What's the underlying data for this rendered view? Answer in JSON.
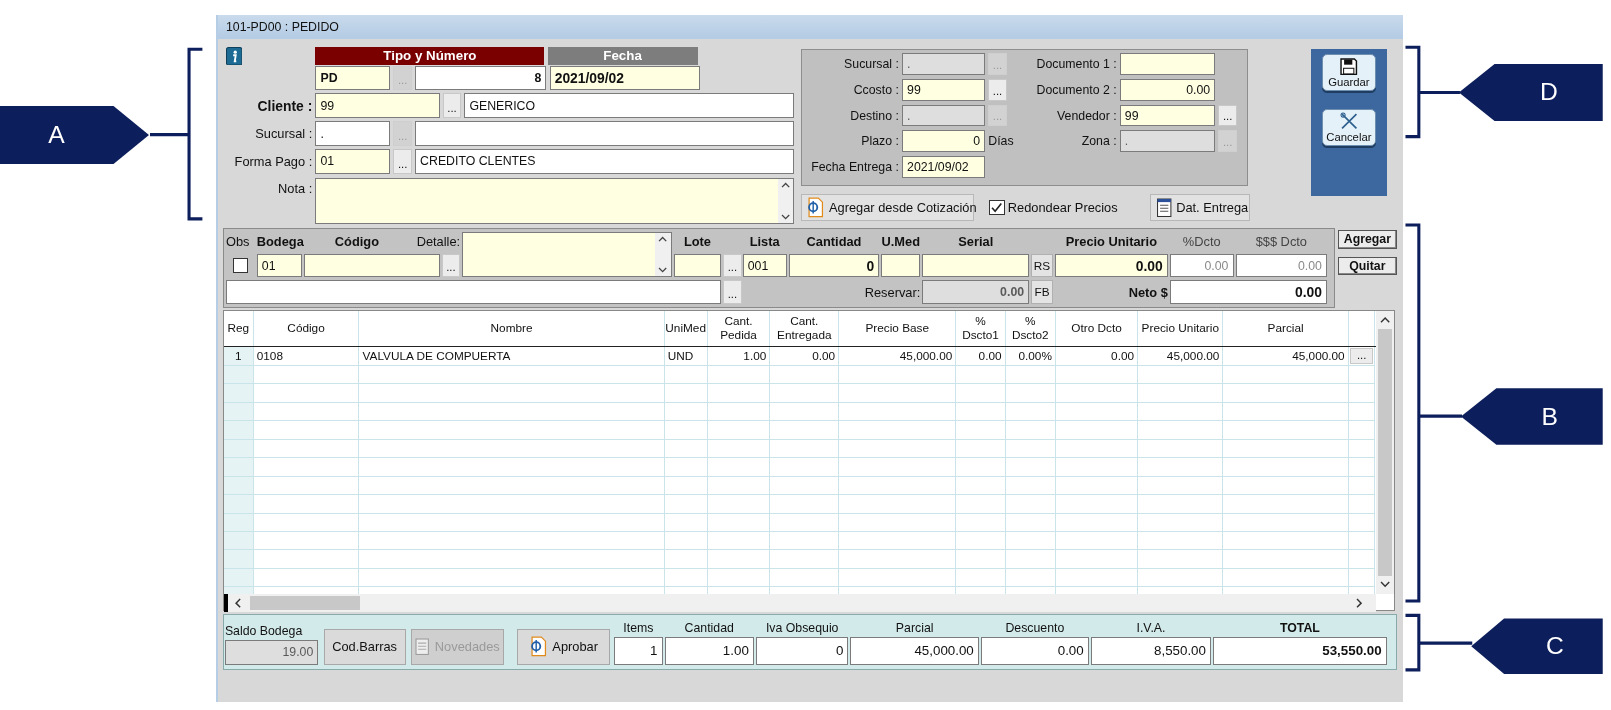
{
  "window": {
    "title": "101-PD00 : PEDIDO"
  },
  "callouts": [
    {
      "label": "A"
    },
    {
      "label": "D"
    },
    {
      "label": "B"
    },
    {
      "label": "C"
    }
  ],
  "header": {
    "type_heading": "Tipo y Número",
    "date_heading": "Fecha",
    "type": {
      "value": "PD",
      "lookup": "...",
      "lookup_disabled": true
    },
    "number": "8",
    "date": "2021/09/02",
    "rows": [
      {
        "label": "Cliente :",
        "required": true,
        "code": "99",
        "editable": true,
        "lookup": "...",
        "lookup_disabled": false,
        "name": "GENERICO"
      },
      {
        "label": "Sucursal :",
        "required": false,
        "code": ".",
        "editable": false,
        "lookup": "...",
        "lookup_disabled": true
      },
      {
        "label": "Forma Pago :",
        "required": false,
        "code": "01",
        "editable": true,
        "lookup": "...",
        "lookup_disabled": false,
        "name": "CREDITO CLENTES"
      }
    ],
    "note": {
      "label": "Nota :"
    }
  },
  "details": {
    "left": [
      {
        "label": "Sucursal :",
        "kind": "text",
        "value": ".",
        "disabled": true,
        "lookup": "..."
      },
      {
        "label": "Ccosto :",
        "kind": "text",
        "value": "99",
        "disabled": false,
        "lookup": "..."
      },
      {
        "label": "Destino :",
        "kind": "text",
        "value": ".",
        "disabled": true,
        "lookup": "..."
      },
      {
        "label": "Plazo :",
        "kind": "number",
        "value": "0",
        "disabled": false,
        "unit": "Días"
      },
      {
        "label": "Fecha Entrega :",
        "kind": "text",
        "value": "2021/09/02",
        "disabled": false
      }
    ],
    "right": [
      {
        "label": "Documento 1 :",
        "kind": "text",
        "disabled": false
      },
      {
        "label": "Documento 2 :",
        "kind": "number",
        "value": "0.00",
        "disabled": false
      },
      {
        "label": "Vendedor :",
        "kind": "text",
        "value": "99",
        "disabled": false,
        "lookup": "..."
      },
      {
        "label": "Zona :",
        "kind": "text",
        "value": ".",
        "disabled": true,
        "lookup": "..."
      }
    ]
  },
  "options": {
    "quote_button": "Agregar desde Cotización",
    "round_prices": {
      "label": "Redondear Precios",
      "checked": true
    },
    "delivery_button": "Dat. Entrega"
  },
  "actions": [
    {
      "label": "Guardar"
    },
    {
      "label": "Cancelar"
    }
  ],
  "entry": {
    "obs": {
      "label": "Obs",
      "checked": false
    },
    "warehouse": {
      "label": "Bodega",
      "value": "01"
    },
    "code": {
      "label": "Código",
      "lookup": "..."
    },
    "detail": {
      "label": "Detalle:"
    },
    "lot": {
      "label": "Lote",
      "lookup": "..."
    },
    "list": {
      "label": "Lista",
      "value": "001"
    },
    "quantity": {
      "label": "Cantidad",
      "value": "0"
    },
    "unit": {
      "label": "U.Med"
    },
    "serial": {
      "label": "Serial",
      "button": "RS"
    },
    "unit_price": {
      "label": "Precio Unitario",
      "value": "0.00"
    },
    "discount_pct": {
      "label": "%Dcto",
      "placeholder": "0.00"
    },
    "discount_amount": {
      "label": "$$$ Dcto",
      "placeholder": "0.00"
    },
    "note_lookup": "...",
    "reserve": {
      "label": "Reservar:",
      "value": "0.00",
      "button": "FB"
    },
    "net": {
      "label": "Neto $",
      "value": "0.00"
    }
  },
  "entry_actions": [
    "Agregar",
    "Quitar"
  ],
  "table": {
    "columns": [
      "Reg",
      "Código",
      "Nombre",
      "UniMed",
      "Cant. Pedida",
      "Cant. Entregada",
      "Precio Base",
      "% Dscto1",
      "% Dscto2",
      "Otro Dcto",
      "Precio Unitario",
      "Parcial"
    ],
    "rows": [
      {
        "cells": [
          "1",
          "0108",
          "VALVULA DE COMPUERTA",
          "UND",
          "1.00",
          "0.00",
          "45,000.00",
          "0.00",
          "0.00%",
          "0.00",
          "45,000.00",
          "45,000.00"
        ],
        "action": "..."
      }
    ]
  },
  "footer": {
    "stock": {
      "label": "Saldo Bodega",
      "value": "19.00"
    },
    "buttons": [
      {
        "label": "Cod.Barras",
        "disabled": false
      },
      {
        "label": "Novedades",
        "disabled": true
      },
      {
        "label": "Aprobar",
        "disabled": false
      }
    ],
    "totals": [
      {
        "label": "Items",
        "value": "1"
      },
      {
        "label": "Cantidad",
        "value": "1.00"
      },
      {
        "label": "Iva Obsequio",
        "value": "0"
      },
      {
        "label": "Parcial",
        "value": "45,000.00"
      },
      {
        "label": "Descuento",
        "value": "0.00"
      },
      {
        "label": "I.V.A.",
        "value": "8,550.00"
      },
      {
        "label": "TOTAL",
        "value": "53,550.00"
      }
    ]
  }
}
